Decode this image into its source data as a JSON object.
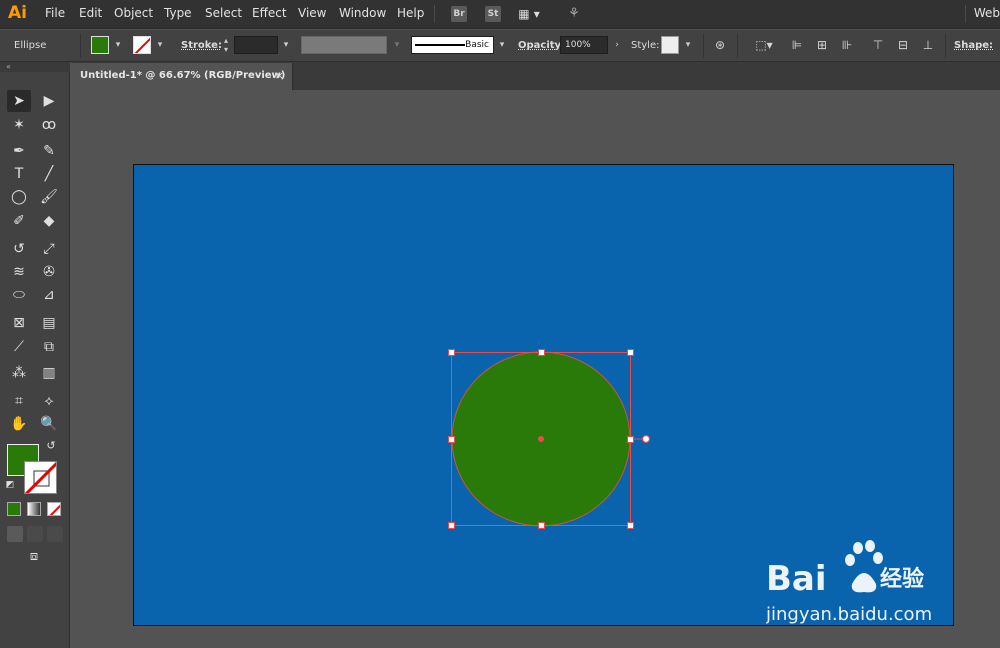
{
  "app": {
    "logo": "Ai"
  },
  "menu": [
    "File",
    "Edit",
    "Object",
    "Type",
    "Select",
    "Effect",
    "View",
    "Window",
    "Help"
  ],
  "menubar_icons": [
    "Br",
    "St"
  ],
  "workspace": "Web",
  "control": {
    "tool_name": "Ellipse",
    "fill_color": "#2a7a0a",
    "stroke_label": "Stroke:",
    "brush_label": "Basic",
    "opacity_label": "Opacity:",
    "opacity_value": "100%",
    "style_label": "Style:",
    "shape_label": "Shape:"
  },
  "document": {
    "tab_title": "Untitled-1* @ 66.67% (RGB/Preview)",
    "close_glyph": "×"
  },
  "canvas": {
    "artboard_color": "#0963ad",
    "circle_fill": "#2a7a0a",
    "selection_color": "#e84c4c"
  },
  "watermark": {
    "brand_text": "Bai",
    "brand_suffix": "经验",
    "url": "jingyan.baidu.com"
  }
}
